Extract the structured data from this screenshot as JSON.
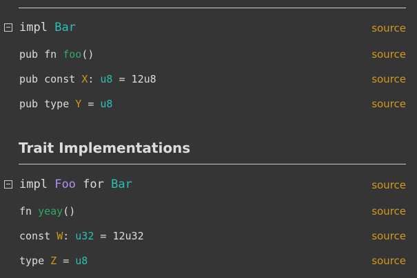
{
  "source_label": "source",
  "inherent_impl": {
    "header": {
      "kw": "impl",
      "type": "Bar"
    },
    "items": [
      {
        "prefix": "pub fn ",
        "name": "foo",
        "suffix": "()"
      },
      {
        "prefix": "pub const ",
        "name": "X",
        "mid": ": ",
        "type": "u8",
        "suffix": " = 12u8"
      },
      {
        "prefix": "pub type ",
        "name": "Y",
        "mid": " = ",
        "type": "u8"
      }
    ]
  },
  "section_title": "Trait Implementations",
  "trait_impl": {
    "header": {
      "kw": "impl",
      "trait": "Foo",
      "for": "for",
      "type": "Bar"
    },
    "items": [
      {
        "prefix": "fn ",
        "name": "yeay",
        "suffix": "()"
      },
      {
        "prefix": "const ",
        "name": "W",
        "mid": ": ",
        "type": "u32",
        "suffix": " = 12u32"
      },
      {
        "prefix": "type ",
        "name": "Z",
        "mid": " = ",
        "type": "u8"
      }
    ]
  },
  "colors": {
    "background": "#353535",
    "type": "#2dbfb8",
    "trait": "#b78cf2",
    "function": "#2bab63",
    "constant": "#d2991d",
    "source_link": "#d2991d"
  }
}
